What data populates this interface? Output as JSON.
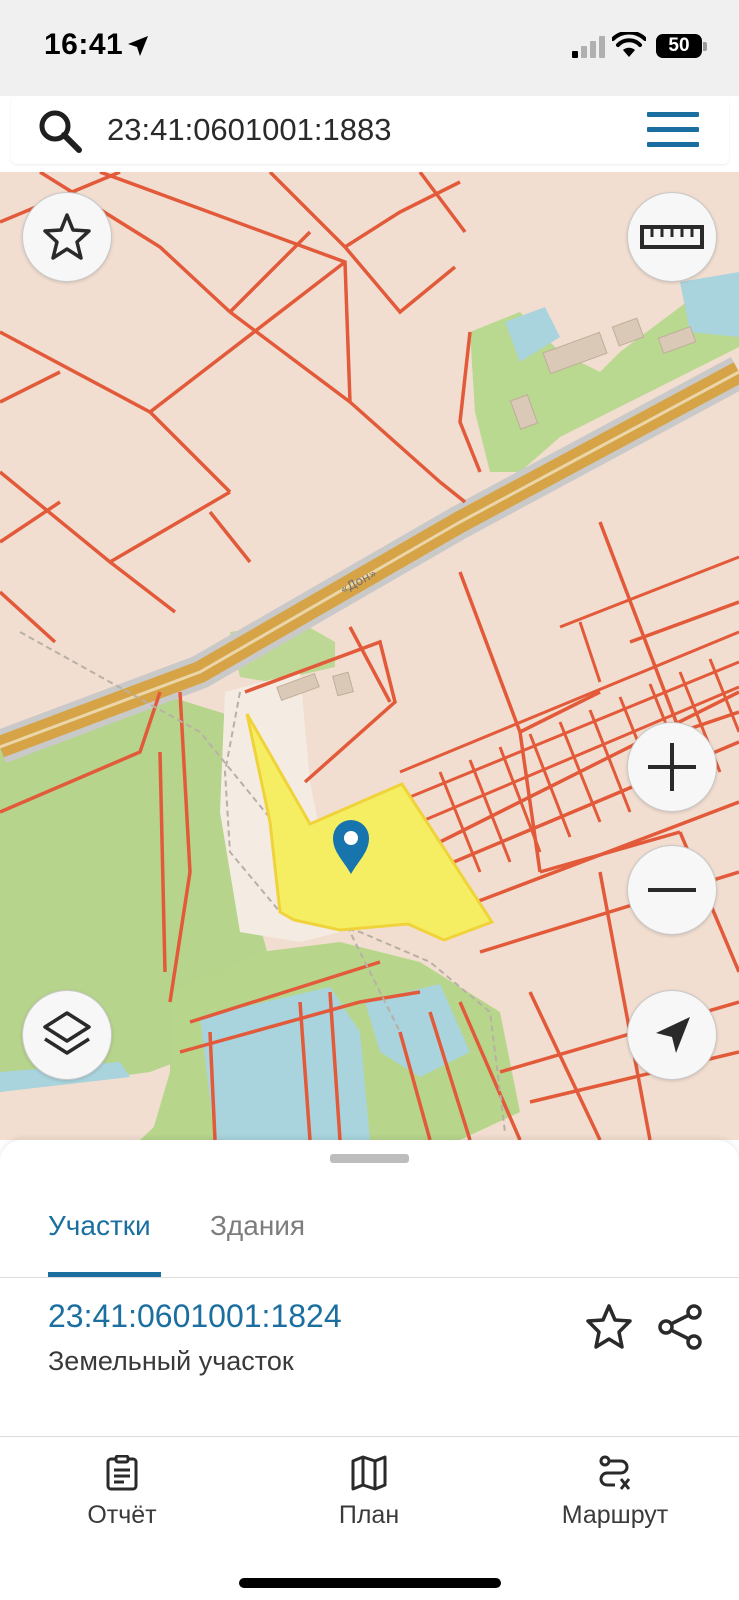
{
  "status_bar": {
    "time": "16:41",
    "battery_level": "50",
    "icons": [
      "location-arrow-icon",
      "cellular-signal-icon",
      "wifi-icon",
      "battery-icon"
    ]
  },
  "search": {
    "value": "23:41:0601001:1883",
    "icons": [
      "search-icon",
      "hamburger-menu-icon"
    ]
  },
  "map": {
    "road_label": "«Дон»",
    "selected_parcel_color": "#f5ee63",
    "parcel_border_color": "#e25a3a",
    "marker_color": "#1874ad",
    "controls": [
      "favorites-button",
      "ruler-button",
      "zoom-in-button",
      "zoom-out-button",
      "layers-button",
      "my-location-button"
    ]
  },
  "sheet": {
    "tabs": [
      {
        "label": "Участки",
        "active": true
      },
      {
        "label": "Здания",
        "active": false
      }
    ],
    "result": {
      "number": "23:41:0601001:1824",
      "type": "Земельный участок"
    }
  },
  "bottom_nav": {
    "items": [
      {
        "label": "Отчёт",
        "icon": "clipboard-icon"
      },
      {
        "label": "План",
        "icon": "map-icon"
      },
      {
        "label": "Маршрут",
        "icon": "route-icon"
      }
    ]
  },
  "colors": {
    "accent": "#1b6fa0",
    "map_background": "#f2ded0",
    "green_area": "#b5d58a",
    "water": "#a9d3dd",
    "road": "#d6a447"
  }
}
